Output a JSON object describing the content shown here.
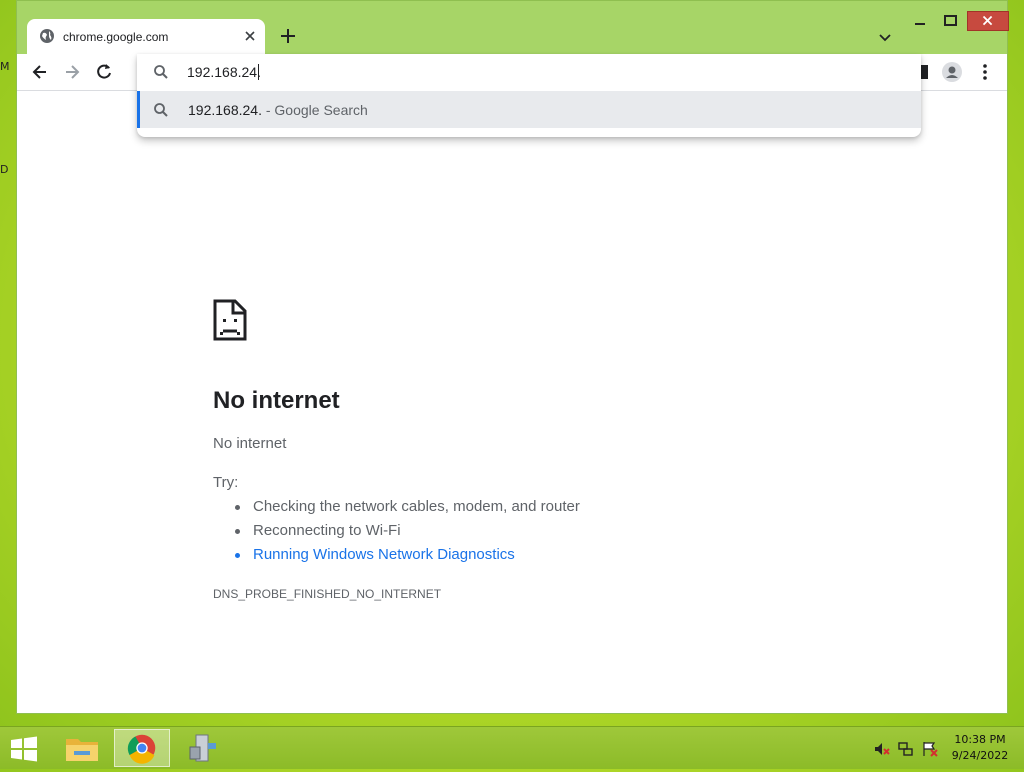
{
  "desktop": {
    "edge_letters": [
      "M",
      "D"
    ]
  },
  "tab": {
    "title": "chrome.google.com"
  },
  "omnibox": {
    "value": "192.168.24.",
    "suggestion_main": "192.168.24.",
    "suggestion_sub": " - Google Search"
  },
  "error": {
    "title": "No internet",
    "subtitle": "No internet",
    "try_label": "Try:",
    "suggestions": [
      "Checking the network cables, modem, and router",
      "Reconnecting to Wi-Fi",
      "Running Windows Network Diagnostics"
    ],
    "code": "DNS_PROBE_FINISHED_NO_INTERNET"
  },
  "clock": {
    "time": "10:38 PM",
    "date": "9/24/2022"
  },
  "colors": {
    "accent_blue": "#1a73e8",
    "close_button": "#c74a3f",
    "frame_green": "#a7d567",
    "taskbar_green": "#8cbb28"
  },
  "icons": [
    "globe-icon",
    "close-icon",
    "plus-icon",
    "chevron-down-icon",
    "minimize-icon",
    "maximize-icon",
    "back-icon",
    "forward-icon",
    "reload-icon",
    "search-icon",
    "side-panel-icon",
    "profile-icon",
    "menu-icon",
    "sad-page-icon",
    "windows-start-icon",
    "file-explorer-icon",
    "chrome-icon",
    "network-tool-icon",
    "speaker-muted-icon",
    "network-icon",
    "flag-icon"
  ]
}
